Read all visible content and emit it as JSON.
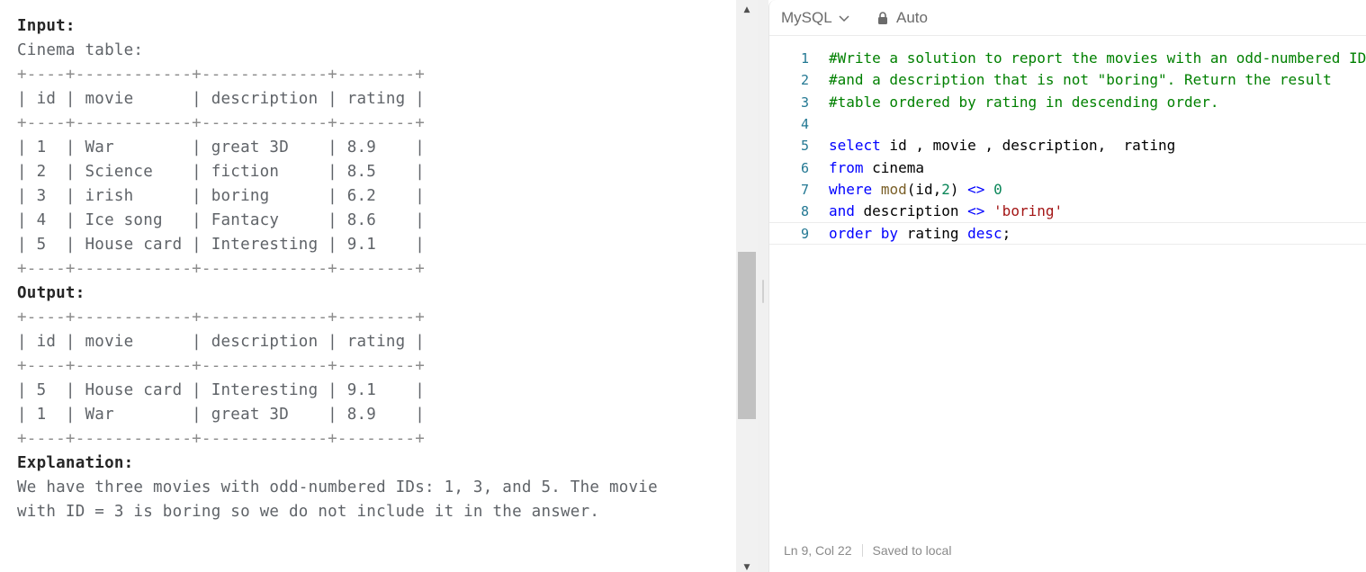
{
  "description": {
    "lines": [
      {
        "text": "Input:",
        "style": "strong"
      },
      {
        "text": "Cinema table:",
        "style": "normal"
      },
      {
        "text": "+----+------------+-------------+--------+",
        "style": "border"
      },
      {
        "text": "| id | movie      | description | rating |",
        "style": "normal"
      },
      {
        "text": "+----+------------+-------------+--------+",
        "style": "border"
      },
      {
        "text": "| 1  | War        | great 3D    | 8.9    |",
        "style": "normal"
      },
      {
        "text": "| 2  | Science    | fiction     | 8.5    |",
        "style": "normal"
      },
      {
        "text": "| 3  | irish      | boring      | 6.2    |",
        "style": "normal"
      },
      {
        "text": "| 4  | Ice song   | Fantacy     | 8.6    |",
        "style": "normal"
      },
      {
        "text": "| 5  | House card | Interesting | 9.1    |",
        "style": "normal"
      },
      {
        "text": "+----+------------+-------------+--------+",
        "style": "border"
      },
      {
        "text": "Output:",
        "style": "strong"
      },
      {
        "text": "+----+------------+-------------+--------+",
        "style": "border"
      },
      {
        "text": "| id | movie      | description | rating |",
        "style": "normal"
      },
      {
        "text": "+----+------------+-------------+--------+",
        "style": "border"
      },
      {
        "text": "| 5  | House card | Interesting | 9.1    |",
        "style": "normal"
      },
      {
        "text": "| 1  | War        | great 3D    | 8.9    |",
        "style": "normal"
      },
      {
        "text": "+----+------------+-------------+--------+",
        "style": "border"
      },
      {
        "text": "Explanation:",
        "style": "strong"
      },
      {
        "text": "We have three movies with odd-numbered IDs: 1, 3, and 5. The movie",
        "style": "normal"
      },
      {
        "text": "with ID = 3 is boring so we do not include it in the answer.",
        "style": "normal"
      }
    ]
  },
  "scrollbar": {
    "up_icon": "triangle-up-icon",
    "down_icon": "triangle-down-icon"
  },
  "editor": {
    "language": "MySQL",
    "mode": "Auto",
    "active_line": 9,
    "code_lines": [
      {
        "num": "1",
        "tokens": [
          {
            "t": "#Write a solution to report the movies with an odd-numbered ID",
            "c": "comment"
          }
        ]
      },
      {
        "num": "2",
        "tokens": [
          {
            "t": "#and a description that is not \"boring\". Return the result",
            "c": "comment"
          }
        ]
      },
      {
        "num": "3",
        "tokens": [
          {
            "t": "#table ordered by rating in descending order.",
            "c": "comment"
          }
        ]
      },
      {
        "num": "4",
        "tokens": []
      },
      {
        "num": "5",
        "tokens": [
          {
            "t": "select",
            "c": "kw"
          },
          {
            "t": " id , movie , description,  rating",
            "c": "txt"
          }
        ]
      },
      {
        "num": "6",
        "tokens": [
          {
            "t": "from",
            "c": "kw"
          },
          {
            "t": " cinema",
            "c": "txt"
          }
        ]
      },
      {
        "num": "7",
        "tokens": [
          {
            "t": "where",
            "c": "kw"
          },
          {
            "t": " ",
            "c": "txt"
          },
          {
            "t": "mod",
            "c": "fn"
          },
          {
            "t": "(id,",
            "c": "txt"
          },
          {
            "t": "2",
            "c": "num"
          },
          {
            "t": ") ",
            "c": "txt"
          },
          {
            "t": "<>",
            "c": "kw"
          },
          {
            "t": " ",
            "c": "txt"
          },
          {
            "t": "0",
            "c": "num"
          }
        ]
      },
      {
        "num": "8",
        "tokens": [
          {
            "t": "and",
            "c": "kw"
          },
          {
            "t": " description ",
            "c": "txt"
          },
          {
            "t": "<>",
            "c": "kw"
          },
          {
            "t": " ",
            "c": "txt"
          },
          {
            "t": "'boring'",
            "c": "str"
          }
        ]
      },
      {
        "num": "9",
        "tokens": [
          {
            "t": "order by",
            "c": "kw"
          },
          {
            "t": " rating ",
            "c": "txt"
          },
          {
            "t": "desc",
            "c": "kw"
          },
          {
            "t": ";",
            "c": "txt"
          }
        ]
      }
    ],
    "status": {
      "cursor": "Ln 9, Col 22",
      "save_state": "Saved to local"
    }
  }
}
